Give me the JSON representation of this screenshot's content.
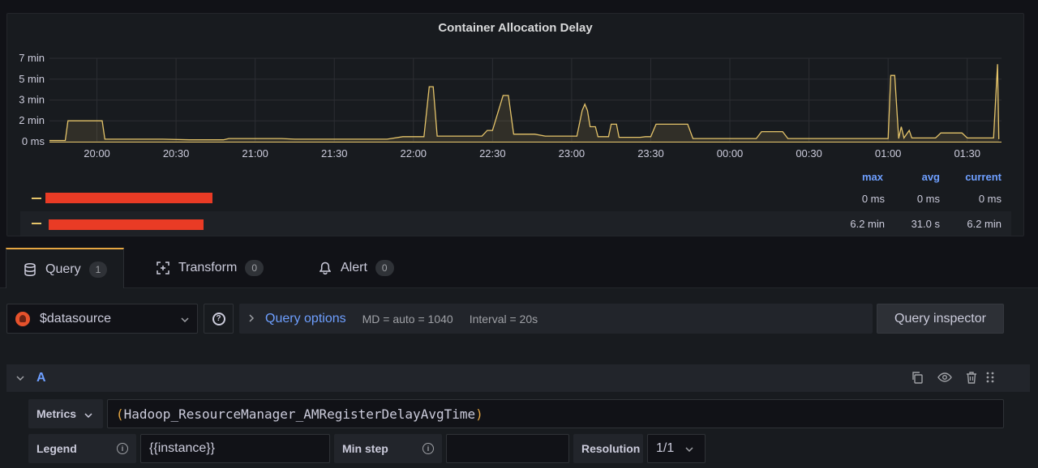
{
  "panel": {
    "title": "Container Allocation Delay",
    "legend": {
      "headers": {
        "max": "max",
        "avg": "avg",
        "current": "current"
      },
      "rows": [
        {
          "name": "[redacted]",
          "max": "0 ms",
          "avg": "0 ms",
          "current": "0 ms"
        },
        {
          "name": "[redacted]",
          "max": "6.2 min",
          "avg": "31.0 s",
          "current": "6.2 min"
        }
      ]
    }
  },
  "chart_data": {
    "type": "line",
    "title": "Container Allocation Delay",
    "xlabel": "",
    "ylabel": "",
    "y_ticks": [
      "0 ms",
      "2 min",
      "3 min",
      "5 min",
      "7 min"
    ],
    "y_tick_values": [
      0,
      1.67,
      3.33,
      5.0,
      6.67
    ],
    "ylim": [
      0,
      6.67
    ],
    "x_ticks": [
      "20:00",
      "20:30",
      "21:00",
      "21:30",
      "22:00",
      "22:30",
      "23:00",
      "23:30",
      "00:00",
      "00:30",
      "01:00",
      "01:30"
    ],
    "x_tick_minutes": [
      0,
      30,
      60,
      90,
      120,
      150,
      180,
      210,
      240,
      270,
      300,
      330
    ],
    "xlim_minutes": [
      -18,
      343
    ],
    "grid": true,
    "series": [
      {
        "color": "#e5c46a",
        "fill": true,
        "points_min_value": [
          [
            -18,
            0.1
          ],
          [
            -12,
            0.1
          ],
          [
            -11,
            1.67
          ],
          [
            2,
            1.67
          ],
          [
            3,
            0.2
          ],
          [
            25,
            0.2
          ],
          [
            35,
            0.15
          ],
          [
            48,
            0.15
          ],
          [
            50,
            0.25
          ],
          [
            70,
            0.25
          ],
          [
            75,
            0.2
          ],
          [
            110,
            0.2
          ],
          [
            116,
            0.4
          ],
          [
            124,
            0.4
          ],
          [
            126,
            4.4
          ],
          [
            127.5,
            4.4
          ],
          [
            129,
            0.45
          ],
          [
            146,
            0.45
          ],
          [
            148,
            0.9
          ],
          [
            150,
            0.9
          ],
          [
            154,
            3.7
          ],
          [
            156,
            3.7
          ],
          [
            158,
            0.6
          ],
          [
            166,
            0.6
          ],
          [
            170,
            0.45
          ],
          [
            182,
            0.45
          ],
          [
            184,
            2.5
          ],
          [
            185,
            3.0
          ],
          [
            186,
            2.5
          ],
          [
            187,
            1.2
          ],
          [
            189,
            1.2
          ],
          [
            190,
            0.4
          ],
          [
            194,
            0.4
          ],
          [
            195,
            1.4
          ],
          [
            197,
            1.4
          ],
          [
            198,
            0.35
          ],
          [
            206,
            0.35
          ],
          [
            208,
            0.4
          ],
          [
            210,
            0.4
          ],
          [
            212,
            1.4
          ],
          [
            224,
            1.4
          ],
          [
            226,
            0.25
          ],
          [
            236,
            0.25
          ],
          [
            240,
            0.25
          ],
          [
            250,
            0.25
          ],
          [
            252,
            0.8
          ],
          [
            260,
            0.8
          ],
          [
            262,
            0.25
          ],
          [
            290,
            0.25
          ],
          [
            300,
            0.25
          ],
          [
            301,
            5.3
          ],
          [
            302.5,
            5.3
          ],
          [
            304,
            0.25
          ],
          [
            305,
            1.2
          ],
          [
            306,
            0.3
          ],
          [
            308,
            0.9
          ],
          [
            309,
            0.3
          ],
          [
            318,
            0.3
          ],
          [
            320,
            0.7
          ],
          [
            328,
            0.7
          ],
          [
            330,
            0.3
          ],
          [
            340,
            0.3
          ],
          [
            341.5,
            6.2
          ],
          [
            342,
            0.2
          ]
        ]
      }
    ]
  },
  "tabs": [
    {
      "label": "Query",
      "count": "1",
      "icon": "database-icon"
    },
    {
      "label": "Transform",
      "count": "0",
      "icon": "transform-icon"
    },
    {
      "label": "Alert",
      "count": "0",
      "icon": "bell-icon"
    }
  ],
  "datasource": {
    "name": "$datasource",
    "icon": "prometheus-icon"
  },
  "query_options": {
    "label": "Query options",
    "md": "MD = auto = 1040",
    "interval": "Interval = 20s"
  },
  "query_inspector": "Query inspector",
  "query_row": {
    "name": "A",
    "metrics_label": "Metrics",
    "metrics_expr_open": "(",
    "metrics_expr": "Hadoop_ResourceManager_AMRegisterDelayAvgTime",
    "metrics_expr_close": ")",
    "legend_label": "Legend",
    "legend_value": "{{instance}}",
    "min_step_label": "Min step",
    "min_step_value": "",
    "resolution_label": "Resolution",
    "resolution_value": "1/1"
  },
  "colors": {
    "accent_blue": "#6e9fff",
    "series_yellow": "#e5c46a",
    "tab_active_border": "#e5a642",
    "redaction": "#e93b25"
  }
}
